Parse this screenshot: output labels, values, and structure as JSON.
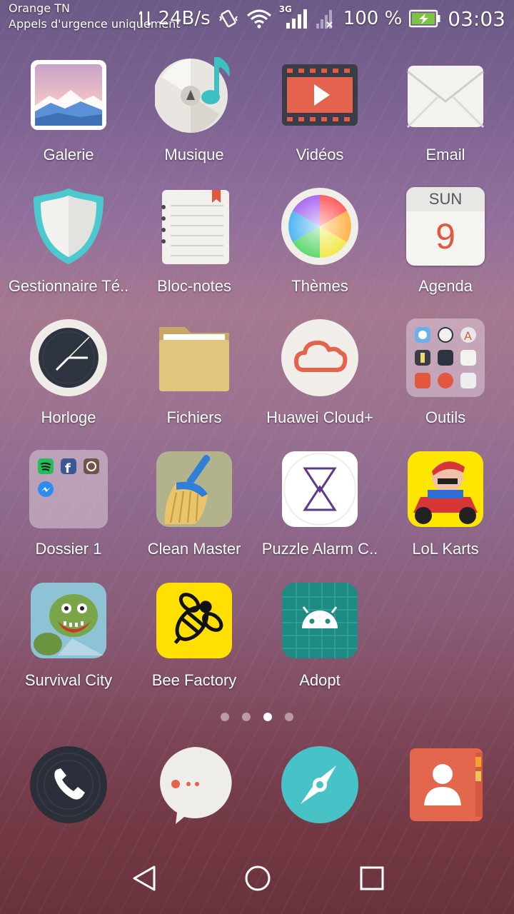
{
  "status_bar": {
    "carrier": "Orange TN",
    "carrier_note": "Appels d'urgence uniquement",
    "net_speed": "24B/s",
    "network_type": "3G",
    "battery": "100 %",
    "time": "03:03"
  },
  "apps": [
    {
      "label": "Galerie",
      "icon": "gallery-icon"
    },
    {
      "label": "Musique",
      "icon": "music-icon"
    },
    {
      "label": "Vidéos",
      "icon": "videos-icon"
    },
    {
      "label": "Email",
      "icon": "email-icon"
    },
    {
      "label": "Gestionnaire Té..",
      "icon": "phone-manager-icon"
    },
    {
      "label": "Bloc-notes",
      "icon": "notepad-icon"
    },
    {
      "label": "Thèmes",
      "icon": "themes-icon"
    },
    {
      "label": "Agenda",
      "icon": "calendar-icon",
      "day": "SUN",
      "date": "9"
    },
    {
      "label": "Horloge",
      "icon": "clock-icon"
    },
    {
      "label": "Fichiers",
      "icon": "files-icon"
    },
    {
      "label": "Huawei Cloud+",
      "icon": "cloud-icon"
    },
    {
      "label": "Outils",
      "icon": "tools-folder-icon"
    },
    {
      "label": "Dossier 1",
      "icon": "folder-icon"
    },
    {
      "label": "Clean Master",
      "icon": "broom-icon"
    },
    {
      "label": "Puzzle Alarm C..",
      "icon": "puzzle-alarm-icon"
    },
    {
      "label": "LoL Karts",
      "icon": "karts-icon"
    },
    {
      "label": "Survival City",
      "icon": "zombie-icon"
    },
    {
      "label": "Bee Factory",
      "icon": "bee-icon"
    },
    {
      "label": "Adopt",
      "icon": "android-icon"
    }
  ],
  "dock": [
    {
      "name": "phone",
      "icon": "phone-icon"
    },
    {
      "name": "messages",
      "icon": "messages-icon"
    },
    {
      "name": "browser",
      "icon": "compass-icon"
    },
    {
      "name": "contacts",
      "icon": "contacts-icon"
    }
  ],
  "pages": {
    "count": 4,
    "active": 3
  },
  "nav": [
    "back",
    "home",
    "recents"
  ]
}
